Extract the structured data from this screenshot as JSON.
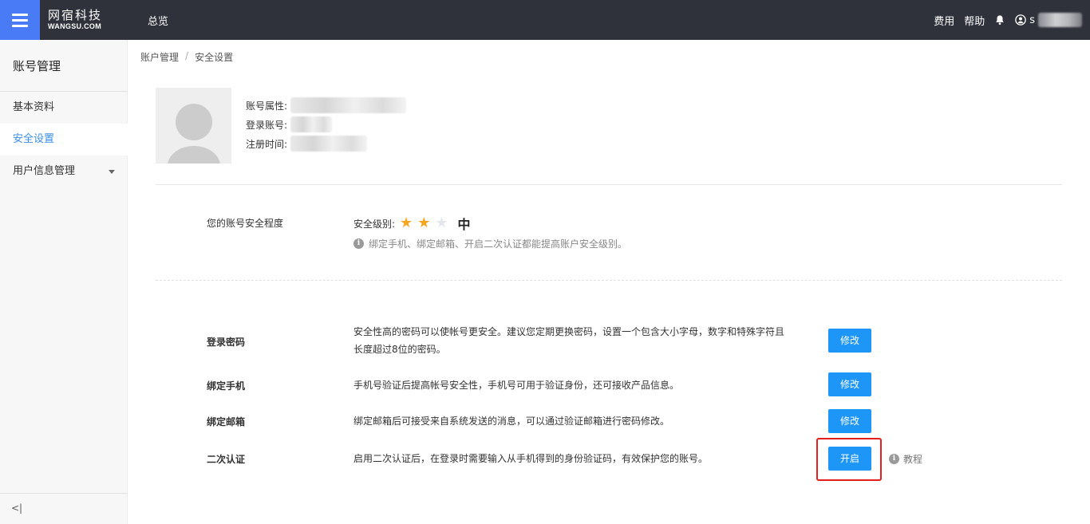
{
  "topbar": {
    "logo_cn": "网宿科技",
    "logo_en": "WANGSU.COM",
    "nav_overview": "总览",
    "fees": "费用",
    "help": "帮助",
    "username_prefix": "s"
  },
  "sidebar": {
    "title": "账号管理",
    "items": [
      {
        "label": "基本资料"
      },
      {
        "label": "安全设置"
      },
      {
        "label": "用户信息管理"
      }
    ],
    "collapse_icon": "<|"
  },
  "breadcrumb": {
    "parent": "账户管理",
    "separator": "/",
    "current": "安全设置"
  },
  "account": {
    "type_label": "账号属性:",
    "login_label": "登录账号:",
    "register_label": "注册时间:"
  },
  "security": {
    "label": "您的账号安全程度",
    "level_label": "安全级别:",
    "stars_filled": 2,
    "stars_total": 3,
    "level_text": "中",
    "hint": "绑定手机、绑定邮箱、开启二次认证都能提高账户安全级别。",
    "colors": {
      "star_on": "#f5a623",
      "star_off": "#e3e6ea"
    }
  },
  "items": [
    {
      "title": "登录密码",
      "desc": "安全性高的密码可以使帐号更安全。建议您定期更换密码，设置一个包含大小字母，数字和特殊字符且长度超过8位的密码。",
      "button": "修改"
    },
    {
      "title": "绑定手机",
      "desc": "手机号验证后提高帐号安全性，手机号可用于验证身份，还可接收产品信息。",
      "button": "修改"
    },
    {
      "title": "绑定邮箱",
      "desc": "绑定邮箱后可接受来自系统发送的消息，可以通过验证邮箱进行密码修改。",
      "button": "修改"
    },
    {
      "title": "二次认证",
      "desc": "启用二次认证后，在登录时需要输入从手机得到的身份验证码，有效保护您的账号。",
      "button": "开启",
      "extra_link": "教程"
    }
  ],
  "colors": {
    "accent": "#1e96f7",
    "menu_btn": "#4a7bf7",
    "topbar": "#2f323b",
    "highlight": "#e02020"
  }
}
